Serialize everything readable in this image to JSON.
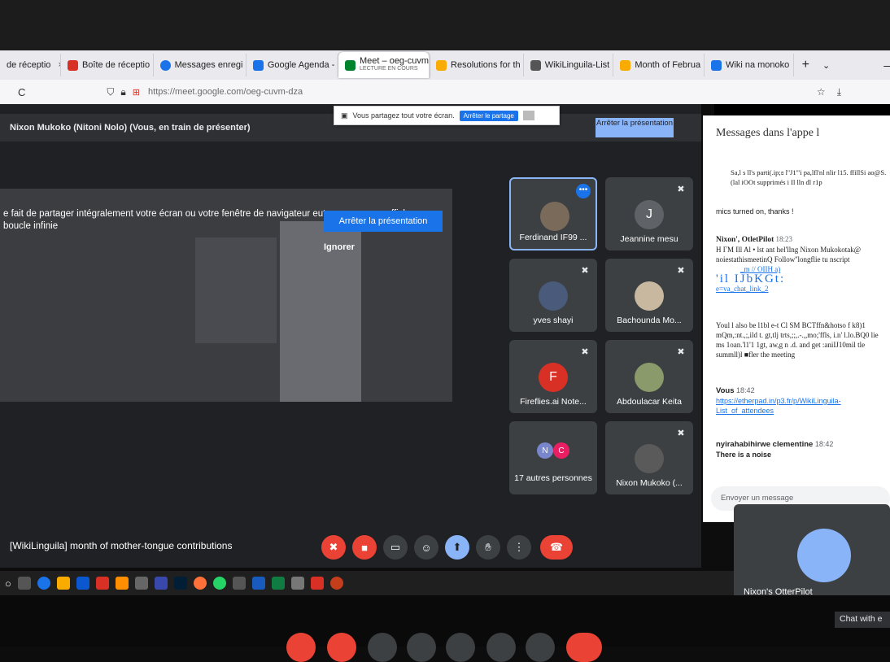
{
  "browser": {
    "tabs": [
      {
        "label": "de réceptio",
        "color": "#999"
      },
      {
        "label": "Boîte de réceptio",
        "color": "#d93025"
      },
      {
        "label": "Messages enregi",
        "color": "#1a73e8"
      },
      {
        "label": "Google Agenda -",
        "color": "#1a73e8"
      },
      {
        "label": "Meet – oeg-cuvm",
        "sublabel": "LECTURE EN COURS",
        "color": "#00832d"
      },
      {
        "label": "Resolutions for th",
        "color": "#f9ab00"
      },
      {
        "label": "WikiLinguila-List",
        "color": "#555"
      },
      {
        "label": "Month of Februa",
        "color": "#f9ab00"
      },
      {
        "label": "Wiki na monoko",
        "color": "#1a73e8"
      }
    ],
    "url": "https://meet.google.com/oeg-cuvm-dza",
    "reload": "C"
  },
  "meet": {
    "presenting_label": "Nixon Mukoko (Nitoni Nolo) (Vous, en train de présenter)",
    "share_notice": "Vous partagez tout votre écran.",
    "share_notice_button": "Arrêter le partage",
    "stop_presenting_top": "Arrêter la présentation",
    "shared_warning": "e fait de partager intégralement votre écran ou votre fenêtre de navigateur eut provoquer un affichage en boucle infinie",
    "stop_presenting": "Arrêter la présentation",
    "ignore": "Ignorer",
    "meeting_title": "[WikiLinguila] month of mother-tongue contributions",
    "participants": [
      {
        "name": "Ferdinand IF99 ...",
        "initial": "",
        "color": "#5f6368"
      },
      {
        "name": "Jeannine mesu",
        "initial": "J",
        "color": "#5f6368"
      },
      {
        "name": "yves shayi",
        "initial": "",
        "color": "#5f6368"
      },
      {
        "name": "Bachounda Mo...",
        "initial": "",
        "color": "#5f6368"
      },
      {
        "name": "Fireflies.ai Note...",
        "initial": "F",
        "color": "#d93025"
      },
      {
        "name": "Abdoulacar Keita",
        "initial": "",
        "color": "#5f6368"
      },
      {
        "name": "17 autres personnes",
        "initial": "N",
        "color": "#7986cb"
      },
      {
        "name": "Nixon Mukoko (...",
        "initial": "",
        "color": "#5f6368"
      }
    ],
    "others_initial_2": "C",
    "otter_name": "Nixon's OtterPilot",
    "chat_with": "Chat with e"
  },
  "chat": {
    "title": "Messages dans l'appe l",
    "messages": [
      {
        "text": "Sa,l s ll's parti(.ip;ɞ l''J1'''i pa,lfl'nl nlir l15. ffillSi ao@S. (lal iOOt supprimés i Il lln dl r1p"
      },
      {
        "text": "mics turned on, thanks !"
      },
      {
        "sender": "Nixon', OtletPilot",
        "time": "18:23",
        "text": "H ΓM Ill Al • lst ant hel'llng Nixon Mukokotak@ noiestathismeetinQ Follow''longflie tu nscript",
        "link1": "_m // OIIH a)",
        "link2": "'il IJbKGt:",
        "link3": "e=va_chat_link_2"
      },
      {
        "text": "Youl l also be l1bl e-t Cl SM BCTffn&hotso f k8)1 mQm,:nt.,;,ild t. gt,tlj trts,;;,.-.,,mo;'ffls, i.n' l.lo.BQ0 lie ms 1oan.'l1'1 1gt, aw,g n .d. and get :aniIJ10mil tle summll)l ■fler the meeting"
      },
      {
        "sender": "Vous",
        "time": "18:42",
        "link": "https://etherpad.in/p3.fr/p/WikiLinguila-List_of_attendees"
      },
      {
        "sender": "nyirahabihirwe clementine",
        "time": "18:42",
        "text": "There is a noise"
      }
    ],
    "input_placeholder": "Envoyer un message"
  },
  "colors": {
    "accent": "#1a73e8",
    "danger": "#ea4335",
    "meet_bg": "#202124",
    "tile_bg": "#3c4043"
  }
}
